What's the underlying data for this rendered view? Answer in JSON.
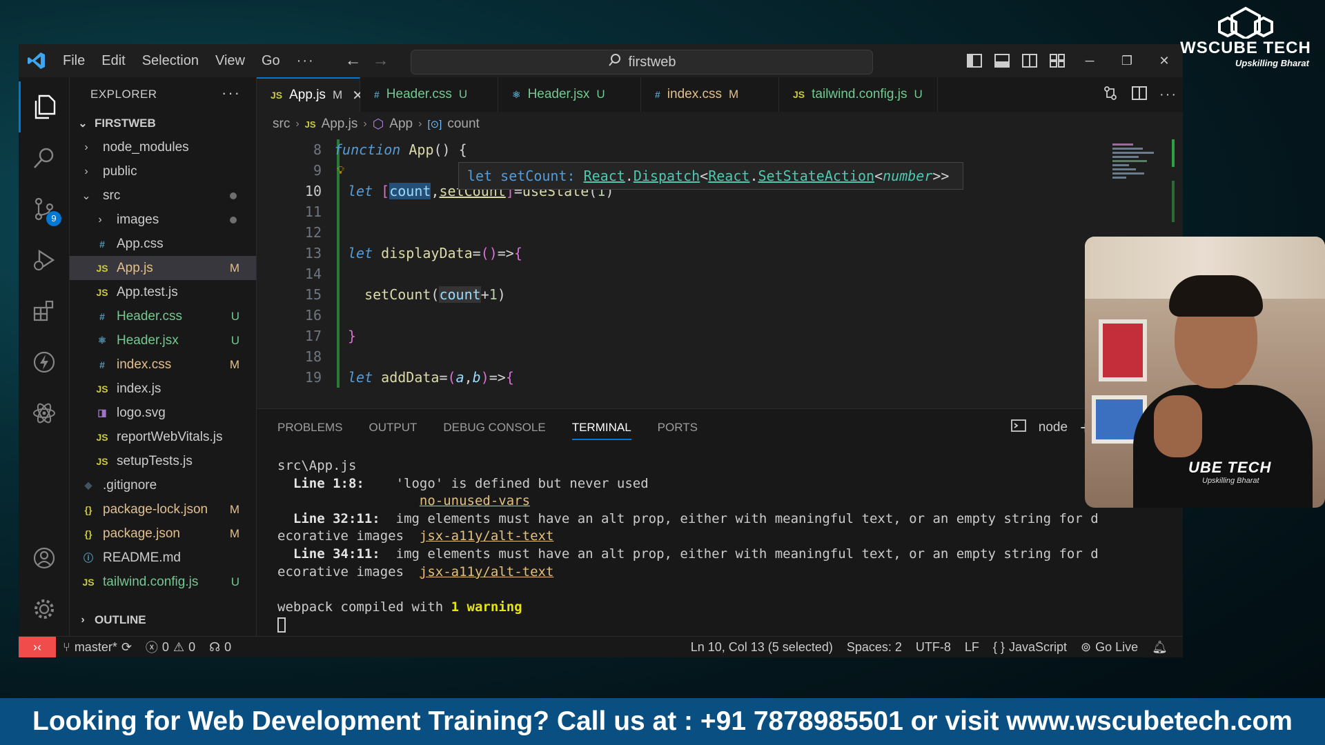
{
  "titlebar": {
    "menu": [
      "File",
      "Edit",
      "Selection",
      "View",
      "Go",
      "···"
    ],
    "search": "firstweb"
  },
  "activity": {
    "source_control_badge": "9"
  },
  "explorer": {
    "title": "EXPLORER",
    "more": "···",
    "root": "FIRSTWEB",
    "outline": "OUTLINE",
    "tree": [
      {
        "name": "node_modules",
        "type": "folder",
        "depth": 1,
        "open": false,
        "status": "",
        "icon": "chevron-right-icon"
      },
      {
        "name": "public",
        "type": "folder",
        "depth": 1,
        "open": false,
        "status": "",
        "icon": "chevron-right-icon"
      },
      {
        "name": "src",
        "type": "folder",
        "depth": 1,
        "open": true,
        "status": "dot",
        "icon": "chevron-down-icon"
      },
      {
        "name": "images",
        "type": "folder",
        "depth": 2,
        "open": false,
        "status": "dot",
        "icon": "chevron-right-icon"
      },
      {
        "name": "App.css",
        "type": "css",
        "depth": 2,
        "status": "",
        "glyph": "#"
      },
      {
        "name": "App.js",
        "type": "js",
        "depth": 2,
        "status": "M",
        "glyph": "JS",
        "selected": true
      },
      {
        "name": "App.test.js",
        "type": "js",
        "depth": 2,
        "status": "",
        "glyph": "JS"
      },
      {
        "name": "Header.css",
        "type": "css",
        "depth": 2,
        "status": "U",
        "glyph": "#"
      },
      {
        "name": "Header.jsx",
        "type": "react",
        "depth": 2,
        "status": "U",
        "glyph": "⚛"
      },
      {
        "name": "index.css",
        "type": "css",
        "depth": 2,
        "status": "M",
        "glyph": "#"
      },
      {
        "name": "index.js",
        "type": "js",
        "depth": 2,
        "status": "",
        "glyph": "JS"
      },
      {
        "name": "logo.svg",
        "type": "svg",
        "depth": 2,
        "status": "",
        "glyph": "◨"
      },
      {
        "name": "reportWebVitals.js",
        "type": "js",
        "depth": 2,
        "status": "",
        "glyph": "JS"
      },
      {
        "name": "setupTests.js",
        "type": "js",
        "depth": 2,
        "status": "",
        "glyph": "JS"
      },
      {
        "name": ".gitignore",
        "type": "git",
        "depth": 1,
        "status": "",
        "glyph": "◆"
      },
      {
        "name": "package-lock.json",
        "type": "json",
        "depth": 1,
        "status": "M",
        "glyph": "{}"
      },
      {
        "name": "package.json",
        "type": "json",
        "depth": 1,
        "status": "M",
        "glyph": "{}"
      },
      {
        "name": "README.md",
        "type": "info",
        "depth": 1,
        "status": "",
        "glyph": "ⓘ"
      },
      {
        "name": "tailwind.config.js",
        "type": "js",
        "depth": 1,
        "status": "U",
        "glyph": "JS"
      }
    ]
  },
  "tabs": [
    {
      "label": "App.js",
      "glyph": "JS",
      "type": "js",
      "status": "M",
      "active": true
    },
    {
      "label": "Header.css",
      "glyph": "#",
      "type": "css",
      "status": "U",
      "active": false
    },
    {
      "label": "Header.jsx",
      "glyph": "⚛",
      "type": "react",
      "status": "U",
      "active": false
    },
    {
      "label": "index.css",
      "glyph": "#",
      "type": "css",
      "status": "M",
      "active": false
    },
    {
      "label": "tailwind.config.js",
      "glyph": "JS",
      "type": "js",
      "status": "U",
      "active": false
    }
  ],
  "breadcrumb": {
    "folder": "src",
    "file": "App.js",
    "component": "App",
    "symbol": "count"
  },
  "hover": {
    "text_prefix": "let setCount: ",
    "type_a": "React",
    "type_b": "Dispatch",
    "type_c": "React",
    "type_d": "SetStateAction",
    "type_e": "number"
  },
  "code": {
    "line_numbers": [
      "8",
      "9",
      "10",
      "11",
      "12",
      "13",
      "14",
      "15",
      "16",
      "17",
      "18",
      "19"
    ],
    "current_line": "10"
  },
  "panel": {
    "tabs": [
      "PROBLEMS",
      "OUTPUT",
      "DEBUG CONSOLE",
      "TERMINAL",
      "PORTS"
    ],
    "active_tab": "TERMINAL",
    "shell": "node",
    "terminal": {
      "file": "src\\App.js",
      "w1_ref": "Line 1:8:",
      "w1_msg": "'logo' is defined but never used",
      "w1_rule": "no-unused-vars",
      "w2_ref": "Line 32:11:",
      "w2_msg": "img elements must have an alt prop, either with meaningful text, or an empty string for d",
      "w2_cont": "ecorative images",
      "w2_rule": "jsx-a11y/alt-text",
      "w3_ref": "Line 34:11:",
      "w3_msg": "img elements must have an alt prop, either with meaningful text, or an empty string for d",
      "w3_cont": "ecorative images",
      "w3_rule": "jsx-a11y/alt-text",
      "compiled_prefix": "webpack compiled with ",
      "compiled_warn": "1 warning"
    }
  },
  "statusbar": {
    "branch": "master*",
    "errors": "0",
    "warnings": "0",
    "ports": "0",
    "position": "Ln 10, Col 13 (5 selected)",
    "spaces": "Spaces: 2",
    "encoding": "UTF-8",
    "eol": "LF",
    "language": "JavaScript",
    "golive": "Go Live"
  },
  "brand": {
    "name": "WSCUBE TECH",
    "tagline": "Upskilling Bharat"
  },
  "webcam": {
    "shirt_logo": "UBE TECH",
    "shirt_tagline": "Upskilling Bharat"
  },
  "banner": {
    "text": "Looking for Web Development Training? Call us at : +91 7878985501 or visit www.wscubetech.com"
  },
  "colors": {
    "accent": "#0078d4",
    "remote": "#f14c4c",
    "banner": "#0a4f82",
    "modified": "#e2c08d",
    "untracked": "#73c991"
  }
}
